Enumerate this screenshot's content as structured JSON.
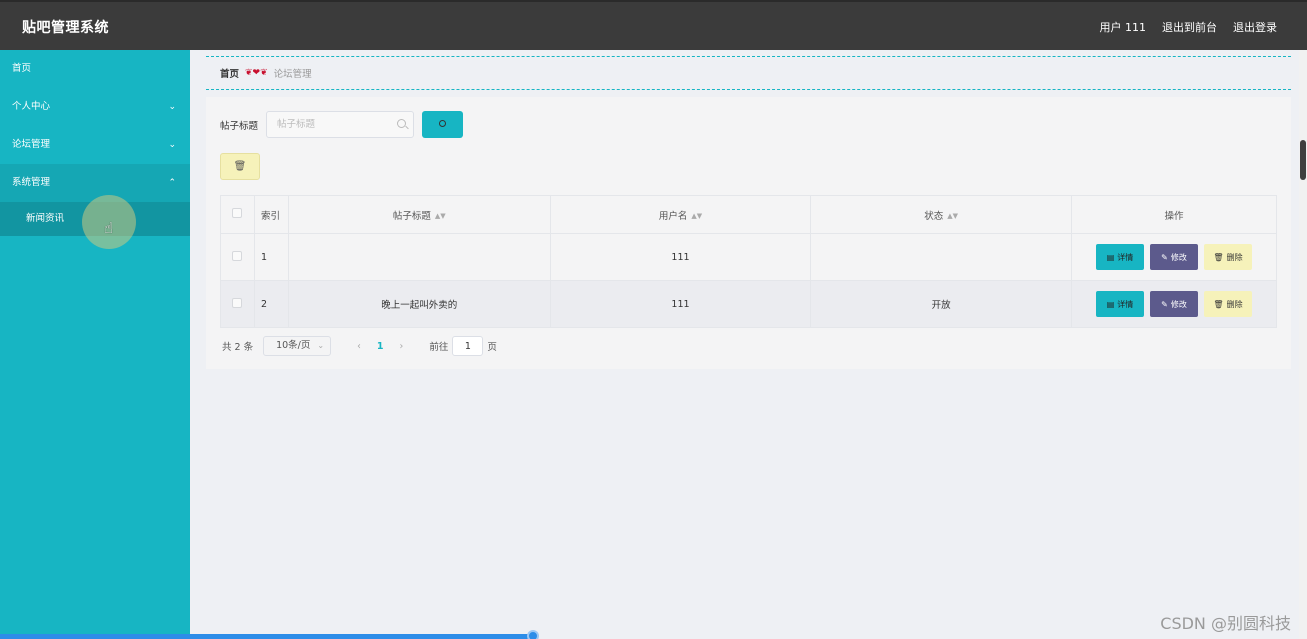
{
  "header": {
    "title": "贴吧管理系统",
    "user_label": "用户 111",
    "back_front": "退出到前台",
    "logout": "退出登录"
  },
  "sidebar": {
    "items": [
      {
        "label": "首页"
      },
      {
        "label": "个人中心",
        "chevron": "⌄"
      },
      {
        "label": "论坛管理",
        "chevron": "⌄"
      },
      {
        "label": "系统管理",
        "chevron": "⌃"
      }
    ],
    "sub_item": "新闻资讯"
  },
  "breadcrumb": {
    "home": "首页",
    "sep": "❦❤❦",
    "current": "论坛管理"
  },
  "search": {
    "label": "帖子标题",
    "placeholder": "帖子标题"
  },
  "table": {
    "headers": {
      "index": "索引",
      "title": "帖子标题",
      "user": "用户名",
      "status": "状态",
      "ops": "操作"
    },
    "rows": [
      {
        "index": "1",
        "title": "",
        "user": "111",
        "status": ""
      },
      {
        "index": "2",
        "title": "晚上一起叫外卖的",
        "user": "111",
        "status": "开放"
      }
    ],
    "actions": {
      "detail": "详情",
      "edit": "修改",
      "delete": "删除"
    }
  },
  "pager": {
    "total": "共 2 条",
    "size": "10条/页",
    "current": "1",
    "goto": "前往",
    "jump_value": "1",
    "page_suffix": "页"
  },
  "watermark": "CSDN @别圆科技",
  "colors": {
    "accent": "#17b5c3",
    "header_bg": "#3b3b3b",
    "edit_btn": "#5c5a8c",
    "delete_btn": "#f6f2ba"
  }
}
